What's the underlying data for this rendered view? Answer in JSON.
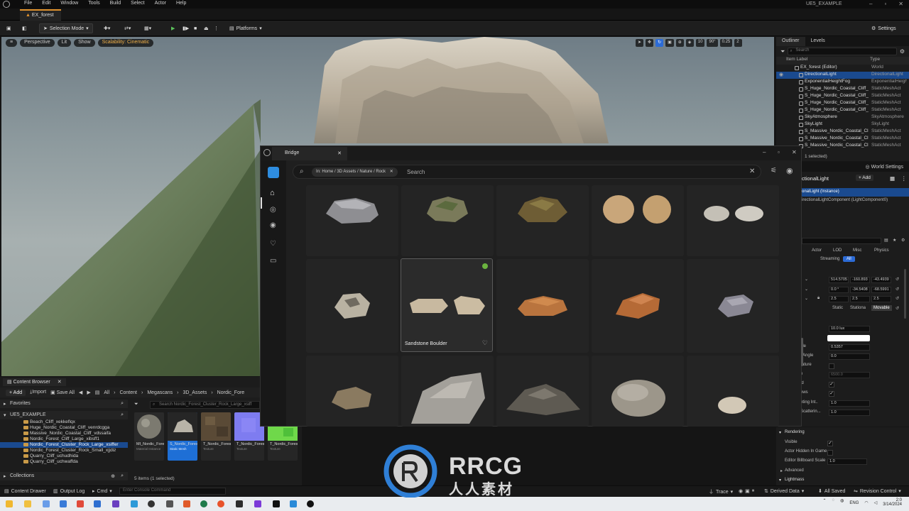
{
  "menu": {
    "items": [
      "File",
      "Edit",
      "Window",
      "Tools",
      "Build",
      "Select",
      "Actor",
      "Help"
    ],
    "project": "UE5_EXAMPLE",
    "level_tab": "EX_forest"
  },
  "toolbar": {
    "selection_mode": "Selection Mode",
    "platforms": "Platforms",
    "settings": "Settings"
  },
  "viewport": {
    "perspective": "Perspective",
    "lit": "Lit",
    "show": "Show",
    "scalability": "Scalability: Cinematic",
    "snap_translate": "10",
    "snap_rotate": "90°",
    "snap_scale": "0.25",
    "camera_speed": "2"
  },
  "outliner": {
    "tab_outliner": "Outliner",
    "tab_levels": "Levels",
    "search_placeholder": "Search",
    "col_label": "Item Label",
    "col_type": "Type",
    "rows": [
      {
        "name": "EX_forest (Editor)",
        "type": "World"
      },
      {
        "name": "DirectionalLight",
        "type": "DirectionalLight"
      },
      {
        "name": "ExponentialHeightFog",
        "type": "ExponentialHeightFog"
      },
      {
        "name": "S_Huge_Nordic_Coastal_Cliff_",
        "type": "StaticMeshAct"
      },
      {
        "name": "S_Huge_Nordic_Coastal_Cliff_",
        "type": "StaticMeshAct"
      },
      {
        "name": "S_Huge_Nordic_Coastal_Cliff_",
        "type": "StaticMeshAct"
      },
      {
        "name": "S_Huge_Nordic_Coastal_Cliff_",
        "type": "StaticMeshAct"
      },
      {
        "name": "SkyAtmosphere",
        "type": "SkyAtmosphere"
      },
      {
        "name": "SkyLight",
        "type": "SkyLight"
      },
      {
        "name": "S_Massive_Nordic_Coastal_Cli",
        "type": "StaticMeshAct"
      },
      {
        "name": "S_Massive_Nordic_Coastal_Cli",
        "type": "StaticMeshAct"
      },
      {
        "name": "S_Massive_Nordic_Coastal_Cli",
        "type": "StaticMeshAct"
      }
    ],
    "selected_count": "1 selected)"
  },
  "details": {
    "world_settings": "World Settings",
    "title": "ctionalLight",
    "add": "+ Add",
    "instance": "onalLight (Instance)",
    "component": "irectionalLightComponent (LightComponent0)",
    "filters": [
      "Actor",
      "LOD",
      "Misc",
      "Physics"
    ],
    "filters2": [
      "Streaming",
      "All"
    ],
    "location": [
      "514.5705",
      "-160.893",
      "-43.4939"
    ],
    "rotation": [
      "0.0 °",
      "-34.5408",
      "-68.5991"
    ],
    "scale": [
      "2.5",
      "2.5",
      "2.5"
    ],
    "mobility": [
      "Static",
      "Stationa",
      "Movable"
    ],
    "intensity": "10.0 lux",
    "angle_label": "gle",
    "angle_val": "0.5357",
    "src_angle_label": "t Angle",
    "src_angle_val": "0.0",
    "temp_label": "rature",
    "temp_val": "6500.0",
    "r1": "e",
    "r2": "ld",
    "r3": "ows",
    "lighting_label": "hting Int..",
    "lighting_val": "1.0",
    "scatter_label": "Scatterin...",
    "scatter_val": "1.0",
    "rendering": "Rendering",
    "visible": "Visible",
    "hidden_game": "Actor Hidden In Game",
    "billboard": "Editor Billboard Scale",
    "billboard_val": "1.0",
    "advanced": "Advanced",
    "lightmass": "Lightmass"
  },
  "content_browser": {
    "tab": "Content Browser",
    "add": "+ Add",
    "import": "Import",
    "save_all": "Save All",
    "crumbs": [
      "All",
      "Content",
      "Megascans",
      "3D_Assets",
      "Nordic_Fore"
    ],
    "favorites": "Favorites",
    "project": "UE5_EXAMPLE",
    "folders": [
      "Beach_Cliff_xekkeflqx",
      "Huge_Nordic_Coastal_Cliff_venrdcgga",
      "Massive_Nordic_Coastal_Cliff_vdssaifa",
      "Nordic_Forest_Cliff_Large_xibsff1",
      "Nordic_Forest_Cluster_Rock_Large_xsiffer",
      "Nordic_Forest_Cluster_Rock_Small_xjjdiz",
      "Quarry_Cliff_uchudhida",
      "Quarry_Cliff_uchwaffda"
    ],
    "collections": "Collections",
    "search_placeholder": "Search Nordic_Forest_Cluster_Rock_Large_xsiff",
    "assets": [
      {
        "name": "MI_Nordic_Forest_Clust...",
        "type": "Material Instance"
      },
      {
        "name": "S_Nordic_Forest_Clust...",
        "type": "Static Mesh"
      },
      {
        "name": "T_Nordic_Forest_Clust...",
        "type": "Texture"
      },
      {
        "name": "T_Nordic_Forest_Clust...",
        "type": "Texture"
      },
      {
        "name": "T_Nordic_ForestClust...",
        "type": "Texture"
      }
    ],
    "status": "5 items (1 selected)"
  },
  "bridge": {
    "tab": "Bridge",
    "filter_chip": "In: Home / 3D Assets / Nature / Rock",
    "search_placeholder": "Search",
    "hover_card": "Sandstone Boulder"
  },
  "statusbar": {
    "content_drawer": "Content Drawer",
    "output_log": "Output Log",
    "cmd": "Cmd",
    "console_placeholder": "Enter Console Command",
    "trace": "Trace",
    "derived_data": "Derived Data",
    "all_saved": "All Saved",
    "revision_control": "Revision Control"
  },
  "taskbar": {
    "lang": "ENG",
    "time": "2:0",
    "date": "3/14/2024"
  },
  "watermark": {
    "text": "RRCG",
    "sub": "人人素材"
  },
  "colors": {
    "accent": "#2c6bd6",
    "selection": "#1a4a8f",
    "warn": "#f3b24a",
    "download": "#6bb33f"
  }
}
